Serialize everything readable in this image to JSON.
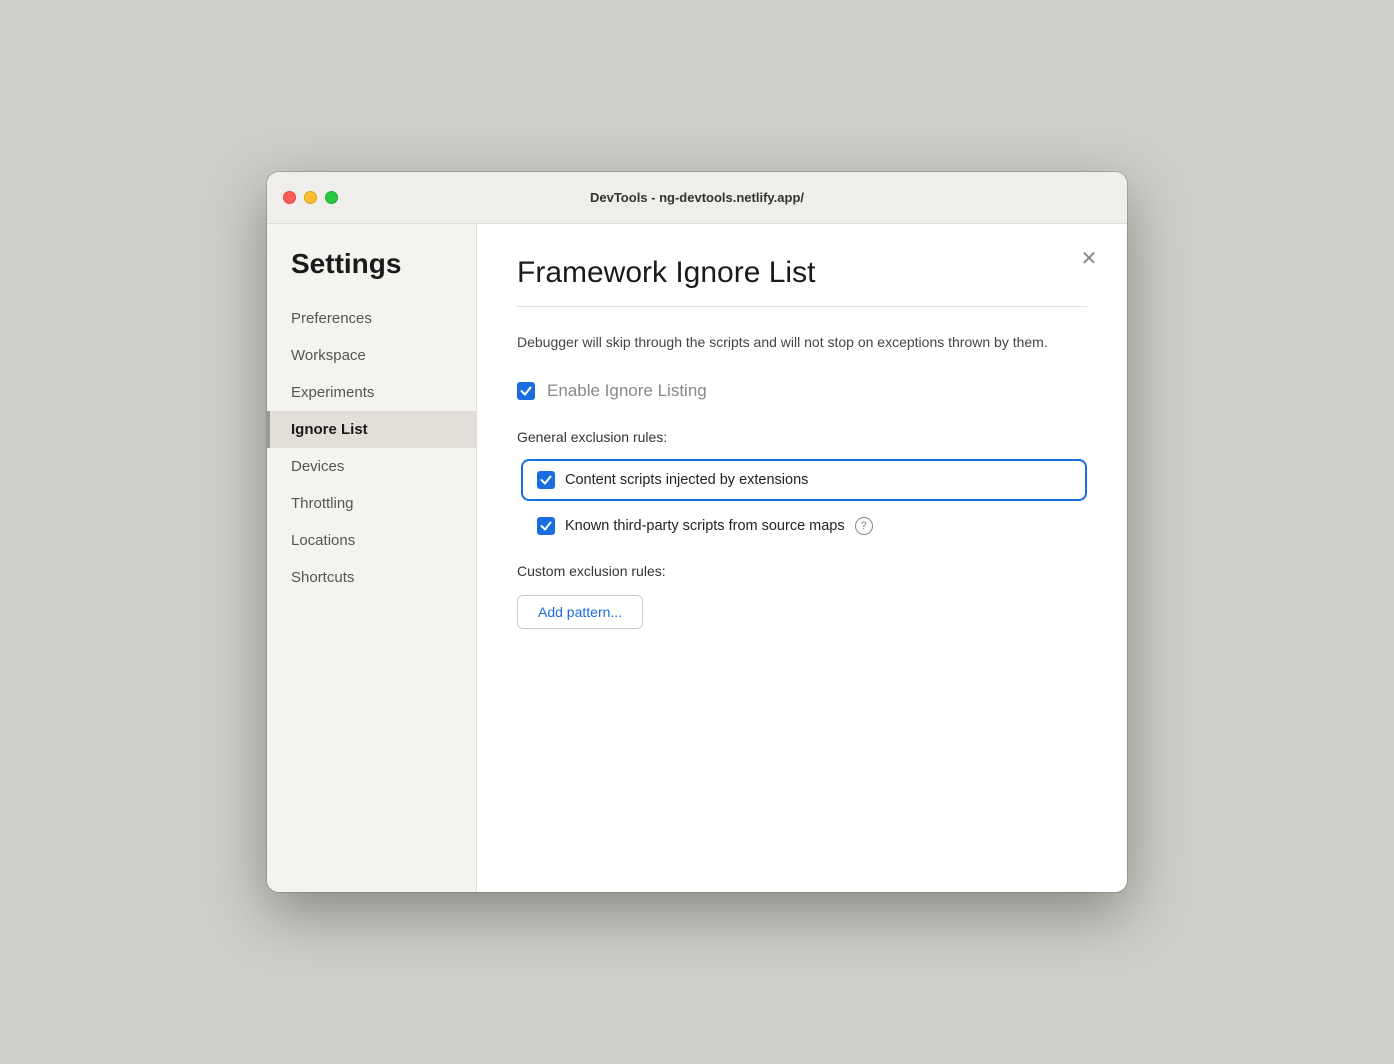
{
  "titlebar": {
    "title": "DevTools - ng-devtools.netlify.app/"
  },
  "sidebar": {
    "heading": "Settings",
    "items": [
      {
        "id": "preferences",
        "label": "Preferences",
        "active": false
      },
      {
        "id": "workspace",
        "label": "Workspace",
        "active": false
      },
      {
        "id": "experiments",
        "label": "Experiments",
        "active": false
      },
      {
        "id": "ignore-list",
        "label": "Ignore List",
        "active": true
      },
      {
        "id": "devices",
        "label": "Devices",
        "active": false
      },
      {
        "id": "throttling",
        "label": "Throttling",
        "active": false
      },
      {
        "id": "locations",
        "label": "Locations",
        "active": false
      },
      {
        "id": "shortcuts",
        "label": "Shortcuts",
        "active": false
      }
    ]
  },
  "content": {
    "title": "Framework Ignore List",
    "description": "Debugger will skip through the scripts and will not stop on exceptions thrown by them.",
    "enable_label": "Enable Ignore Listing",
    "general_section_label": "General exclusion rules:",
    "rules": [
      {
        "id": "content-scripts",
        "label": "Content scripts injected by extensions",
        "checked": true,
        "highlighted": true,
        "has_help": false
      },
      {
        "id": "third-party-scripts",
        "label": "Known third-party scripts from source maps",
        "checked": true,
        "highlighted": false,
        "has_help": true
      }
    ],
    "custom_section_label": "Custom exclusion rules:",
    "add_pattern_label": "Add pattern..."
  },
  "traffic_lights": {
    "close_title": "Close",
    "minimize_title": "Minimize",
    "maximize_title": "Maximize"
  }
}
